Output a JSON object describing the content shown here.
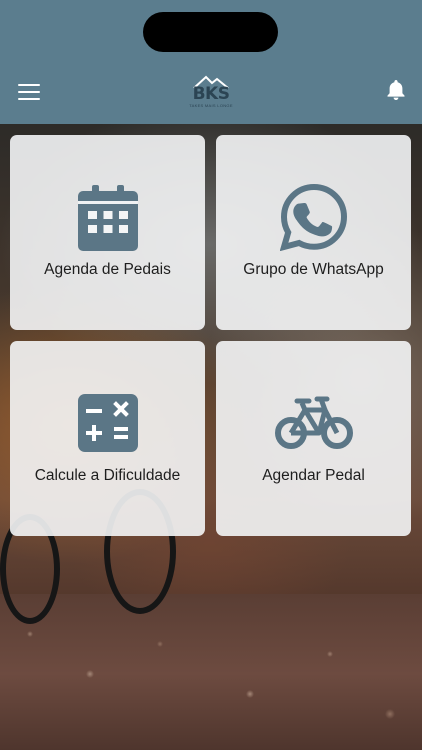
{
  "header": {
    "logo_text": "BKS",
    "logo_subtitle": "TAKES MAIS LONGE",
    "menu_icon": "hamburger-menu-icon",
    "notification_icon": "bell-icon"
  },
  "tiles": [
    {
      "label": "Agenda de Pedais",
      "icon": "calendar-icon"
    },
    {
      "label": "Grupo de WhatsApp",
      "icon": "whatsapp-icon"
    },
    {
      "label": "Calcule a Dificuldade",
      "icon": "calculator-icon"
    },
    {
      "label": "Agendar Pedal",
      "icon": "bicycle-icon"
    }
  ],
  "colors": {
    "header_bg": "#5b7d8e",
    "icon_color": "#5b7686",
    "tile_bg": "#f4f5f6"
  }
}
